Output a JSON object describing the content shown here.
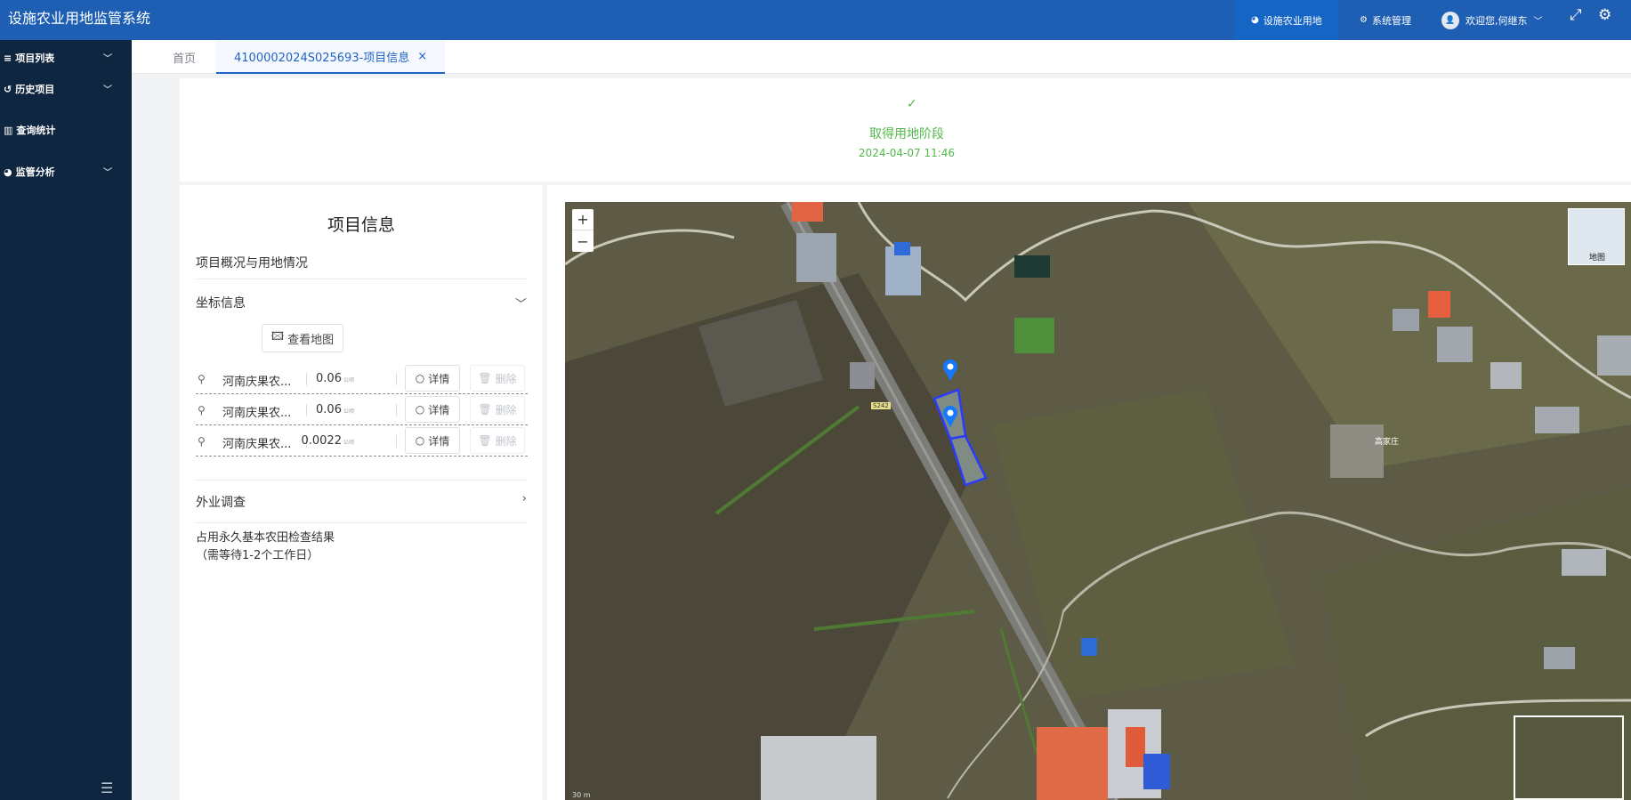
{
  "header": {
    "title": "设施农业用地监管系统",
    "nav": [
      {
        "label": "设施农业用地",
        "icon": "pie-chart-icon"
      },
      {
        "label": "系统管理",
        "icon": "gears-icon"
      }
    ],
    "user": {
      "avatar_text": "👤",
      "greeting": "欢迎您,何继东"
    }
  },
  "sidebar": {
    "items": [
      {
        "label": "项目列表",
        "icon": "list-icon"
      },
      {
        "label": "历史项目",
        "icon": "history-icon"
      },
      {
        "label": "查询统计",
        "icon": "bar-chart-icon"
      },
      {
        "label": "监管分析",
        "icon": "pie-chart-icon"
      }
    ]
  },
  "tabs": [
    {
      "label": "首页"
    },
    {
      "label": "4100002024S025693-项目信息",
      "close": "×"
    }
  ],
  "stage": {
    "name": "取得用地阶段",
    "time": "2024-04-07 11:46"
  },
  "info": {
    "title": "项目信息",
    "section_overview": "项目概况与用地情况",
    "section_coords": "坐标信息",
    "view_map_label": "查看地图",
    "coords": [
      {
        "name": "河南庆果农...",
        "value": "0.06",
        "unit": "公顷",
        "detail": "详情",
        "delete": "删除"
      },
      {
        "name": "河南庆果农...",
        "value": "0.06",
        "unit": "公顷",
        "detail": "详情",
        "delete": "删除"
      },
      {
        "name": "河南庆果农...",
        "value": "0.0022",
        "unit": "公顷",
        "detail": "详情",
        "delete": "删除"
      }
    ],
    "section_field": "外业调查",
    "result_line1": "占用永久基本农田检查结果",
    "result_line2": "（需等待1-2个工作日）"
  },
  "map": {
    "zoom_in": "+",
    "zoom_out": "−",
    "basemap_label": "地图",
    "scale_label": "30 m",
    "village_label": "高家庄",
    "road_label": "S242",
    "colors": {
      "parcel": "#2a3bff",
      "marker": "#1677ff"
    }
  }
}
